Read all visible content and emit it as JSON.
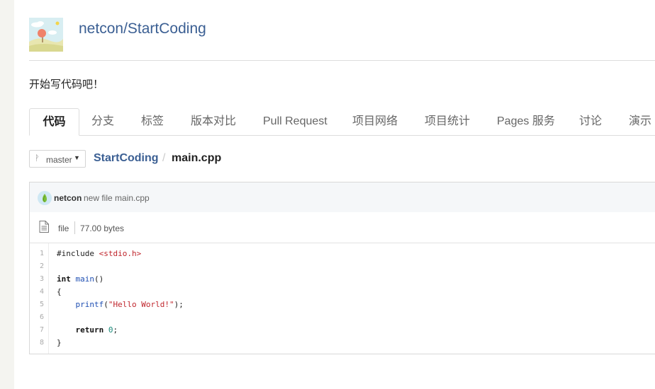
{
  "header": {
    "owner": "netcon",
    "separator": "/",
    "repo": "StartCoding",
    "description": "开始写代码吧！"
  },
  "tabs": [
    {
      "label": "代码",
      "active": true
    },
    {
      "label": "分支",
      "active": false
    },
    {
      "label": "标签",
      "active": false
    },
    {
      "label": "版本对比",
      "active": false
    },
    {
      "label": "Pull Request",
      "active": false
    },
    {
      "label": "项目网络",
      "active": false
    },
    {
      "label": "项目统计",
      "active": false
    },
    {
      "label": "Pages 服务",
      "active": false
    },
    {
      "label": "讨论",
      "active": false
    },
    {
      "label": "演示",
      "active": false
    }
  ],
  "branch": {
    "label": "master",
    "icon": "branch-icon"
  },
  "breadcrumb": {
    "repo": "StartCoding",
    "separator": "/",
    "file": "main.cpp"
  },
  "commit": {
    "author": "netcon",
    "message": "new file main.cpp"
  },
  "file": {
    "type": "file",
    "size": "77.00 bytes",
    "icon": "file-icon"
  },
  "code": {
    "line_numbers": [
      "1",
      "2",
      "3",
      "4",
      "5",
      "6",
      "7",
      "8"
    ],
    "lines": {
      "l1_directive": "#include",
      "l1_header": "<stdio.h>",
      "l3_type": "int",
      "l3_name": "main",
      "l3_parens": "()",
      "l4": "{",
      "l5_fn": "printf",
      "l5_open": "(",
      "l5_str": "\"Hello World!\"",
      "l5_close": ");",
      "l7_kw": "return",
      "l7_num": "0",
      "l7_semi": ";",
      "l8": "}"
    }
  },
  "colors": {
    "link": "#3b5f93",
    "string": "#c0262d",
    "function": "#1f4fb3",
    "number": "#1a8a7a"
  }
}
